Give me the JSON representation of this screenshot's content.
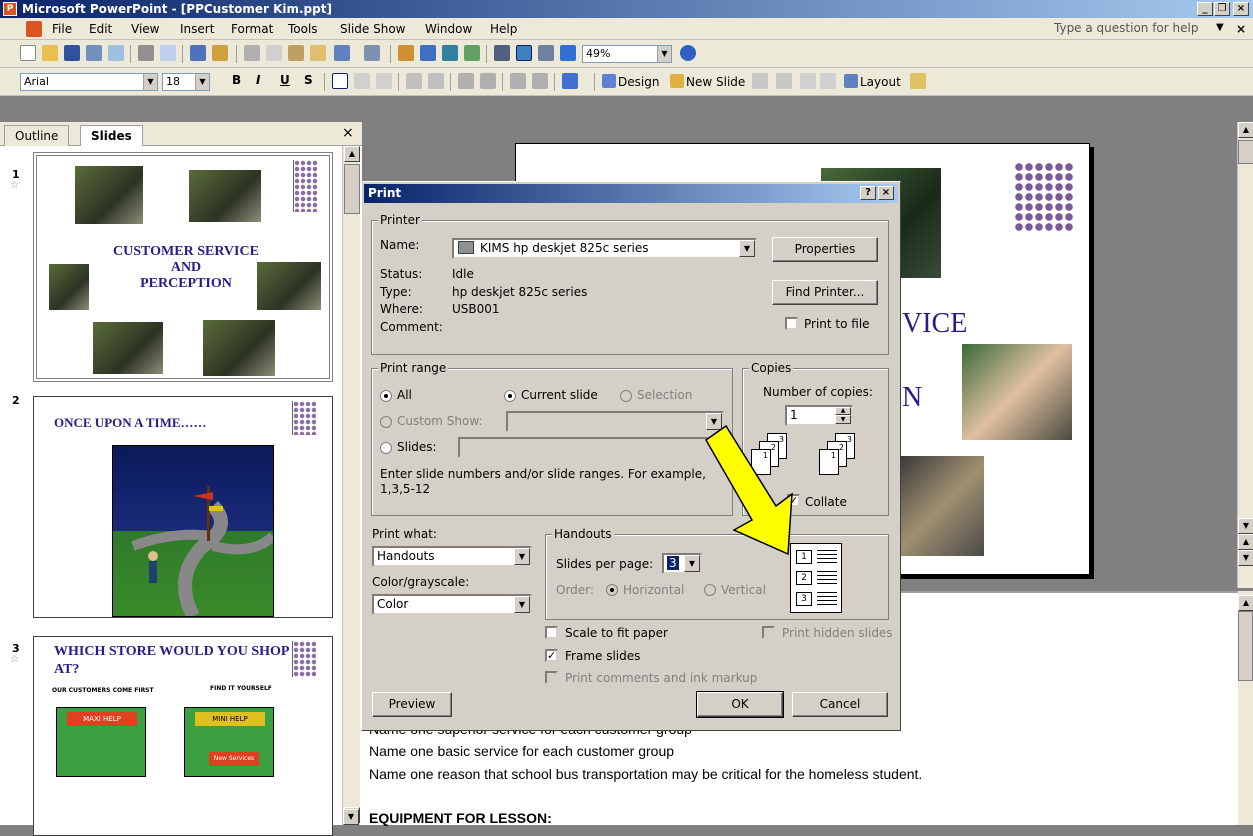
{
  "window": {
    "title": "Microsoft PowerPoint - [PPCustomer  Kim.ppt]",
    "app_icon": "powerpoint-icon"
  },
  "menu": {
    "items": [
      "File",
      "Edit",
      "View",
      "Insert",
      "Format",
      "Tools",
      "Slide Show",
      "Window",
      "Help"
    ],
    "help_placeholder": "Type a question for help"
  },
  "standard_toolbar": {
    "zoom": "49%"
  },
  "formatting_toolbar": {
    "font": "Arial",
    "size": "18",
    "bold": "B",
    "italic": "I",
    "underline": "U",
    "shadow": "S",
    "design_label": "Design",
    "new_slide_label": "New Slide",
    "layout_label": "Layout"
  },
  "panes": {
    "tabs": [
      "Outline",
      "Slides"
    ],
    "close": "×"
  },
  "slides": [
    {
      "num": "1",
      "title": "CUSTOMER SERVICE\nAND\nPERCEPTION"
    },
    {
      "num": "2",
      "title": "ONCE UPON A TIME……"
    },
    {
      "num": "3",
      "title": "WHICH STORE WOULD YOU SHOP AT?",
      "left_caption": "OUR CUSTOMERS COME FIRST",
      "right_caption": "FIND IT YOURSELF",
      "sign1": "MAXI HELP",
      "sign2": "MINI HELP",
      "sign3": "New Services"
    }
  ],
  "slide_main_text": {
    "line1": "VICE",
    "line2": "N"
  },
  "notes": {
    "line0": "Name one superior service for each customer group",
    "line1": "Name one basic service for each customer group",
    "line2": "Name one reason that school bus transportation may be critical for the homeless student.",
    "line3": "EQUIPMENT FOR LESSON:"
  },
  "dialog": {
    "title": "Print",
    "help": "?",
    "close": "×",
    "printer": {
      "group": "Printer",
      "name_label": "Name:",
      "name_value": "KIMS hp deskjet 825c series",
      "status_label": "Status:",
      "status_value": "Idle",
      "type_label": "Type:",
      "type_value": "hp deskjet 825c series",
      "where_label": "Where:",
      "where_value": "USB001",
      "comment_label": "Comment:",
      "properties": "Properties",
      "find_printer": "Find Printer...",
      "print_to_file": "Print to file"
    },
    "range": {
      "group": "Print range",
      "all": "All",
      "current": "Current slide",
      "selection": "Selection",
      "custom_show": "Custom Show:",
      "slides": "Slides:",
      "hint": "Enter slide numbers and/or slide ranges. For example,\n1,3,5-12"
    },
    "copies": {
      "group": "Copies",
      "label": "Number of copies:",
      "value": "1",
      "collate": "Collate"
    },
    "print_what": {
      "label": "Print what:",
      "value": "Handouts"
    },
    "color": {
      "label": "Color/grayscale:",
      "value": "Color"
    },
    "handouts": {
      "group": "Handouts",
      "per_page_label": "Slides per page:",
      "per_page_value": "3",
      "order_label": "Order:",
      "horizontal": "Horizontal",
      "vertical": "Vertical"
    },
    "options": {
      "scale": "Scale to fit paper",
      "frame": "Frame slides",
      "comments": "Print comments and ink markup",
      "hidden": "Print hidden slides"
    },
    "buttons": {
      "preview": "Preview",
      "ok": "OK",
      "cancel": "Cancel"
    }
  },
  "annotation": {
    "arrow_color": "#ffff00"
  }
}
